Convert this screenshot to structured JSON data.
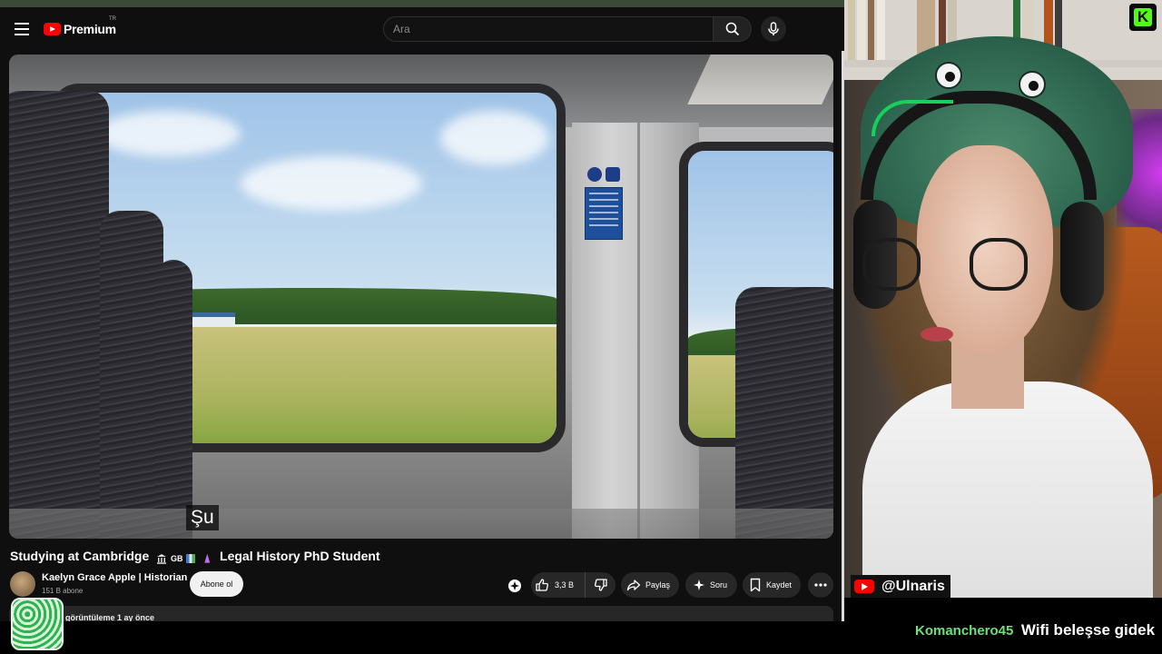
{
  "masthead": {
    "logo_text": "Premium",
    "country_code": "TR",
    "search_placeholder": "Ara",
    "search_icon": "search-icon",
    "mic_icon": "mic-icon"
  },
  "video": {
    "caption": "Şu",
    "title_left": "Studying at Cambridge",
    "title_badges": "GB",
    "title_right": "Legal History PhD Student"
  },
  "channel": {
    "name": "Kaelyn Grace Apple | Historian",
    "subscribers": "151 B abone",
    "subscribe_label": "Abone ol"
  },
  "actions": {
    "likes": "3,3 B",
    "share_label": "Paylaş",
    "ask_label": "Soru",
    "save_label": "Kaydet"
  },
  "description": {
    "preview": "görüntüleme  1 ay önce"
  },
  "stream": {
    "handle": "@Ulnaris",
    "platform_logo": "K"
  },
  "chat": {
    "user": "Komanchero45",
    "message": "Wifi beleşse gidek"
  },
  "colors": {
    "youtube_red": "#ff0000",
    "kick_green": "#53fc18",
    "chat_username": "#6ee07a",
    "background": "#0f0f0f"
  }
}
